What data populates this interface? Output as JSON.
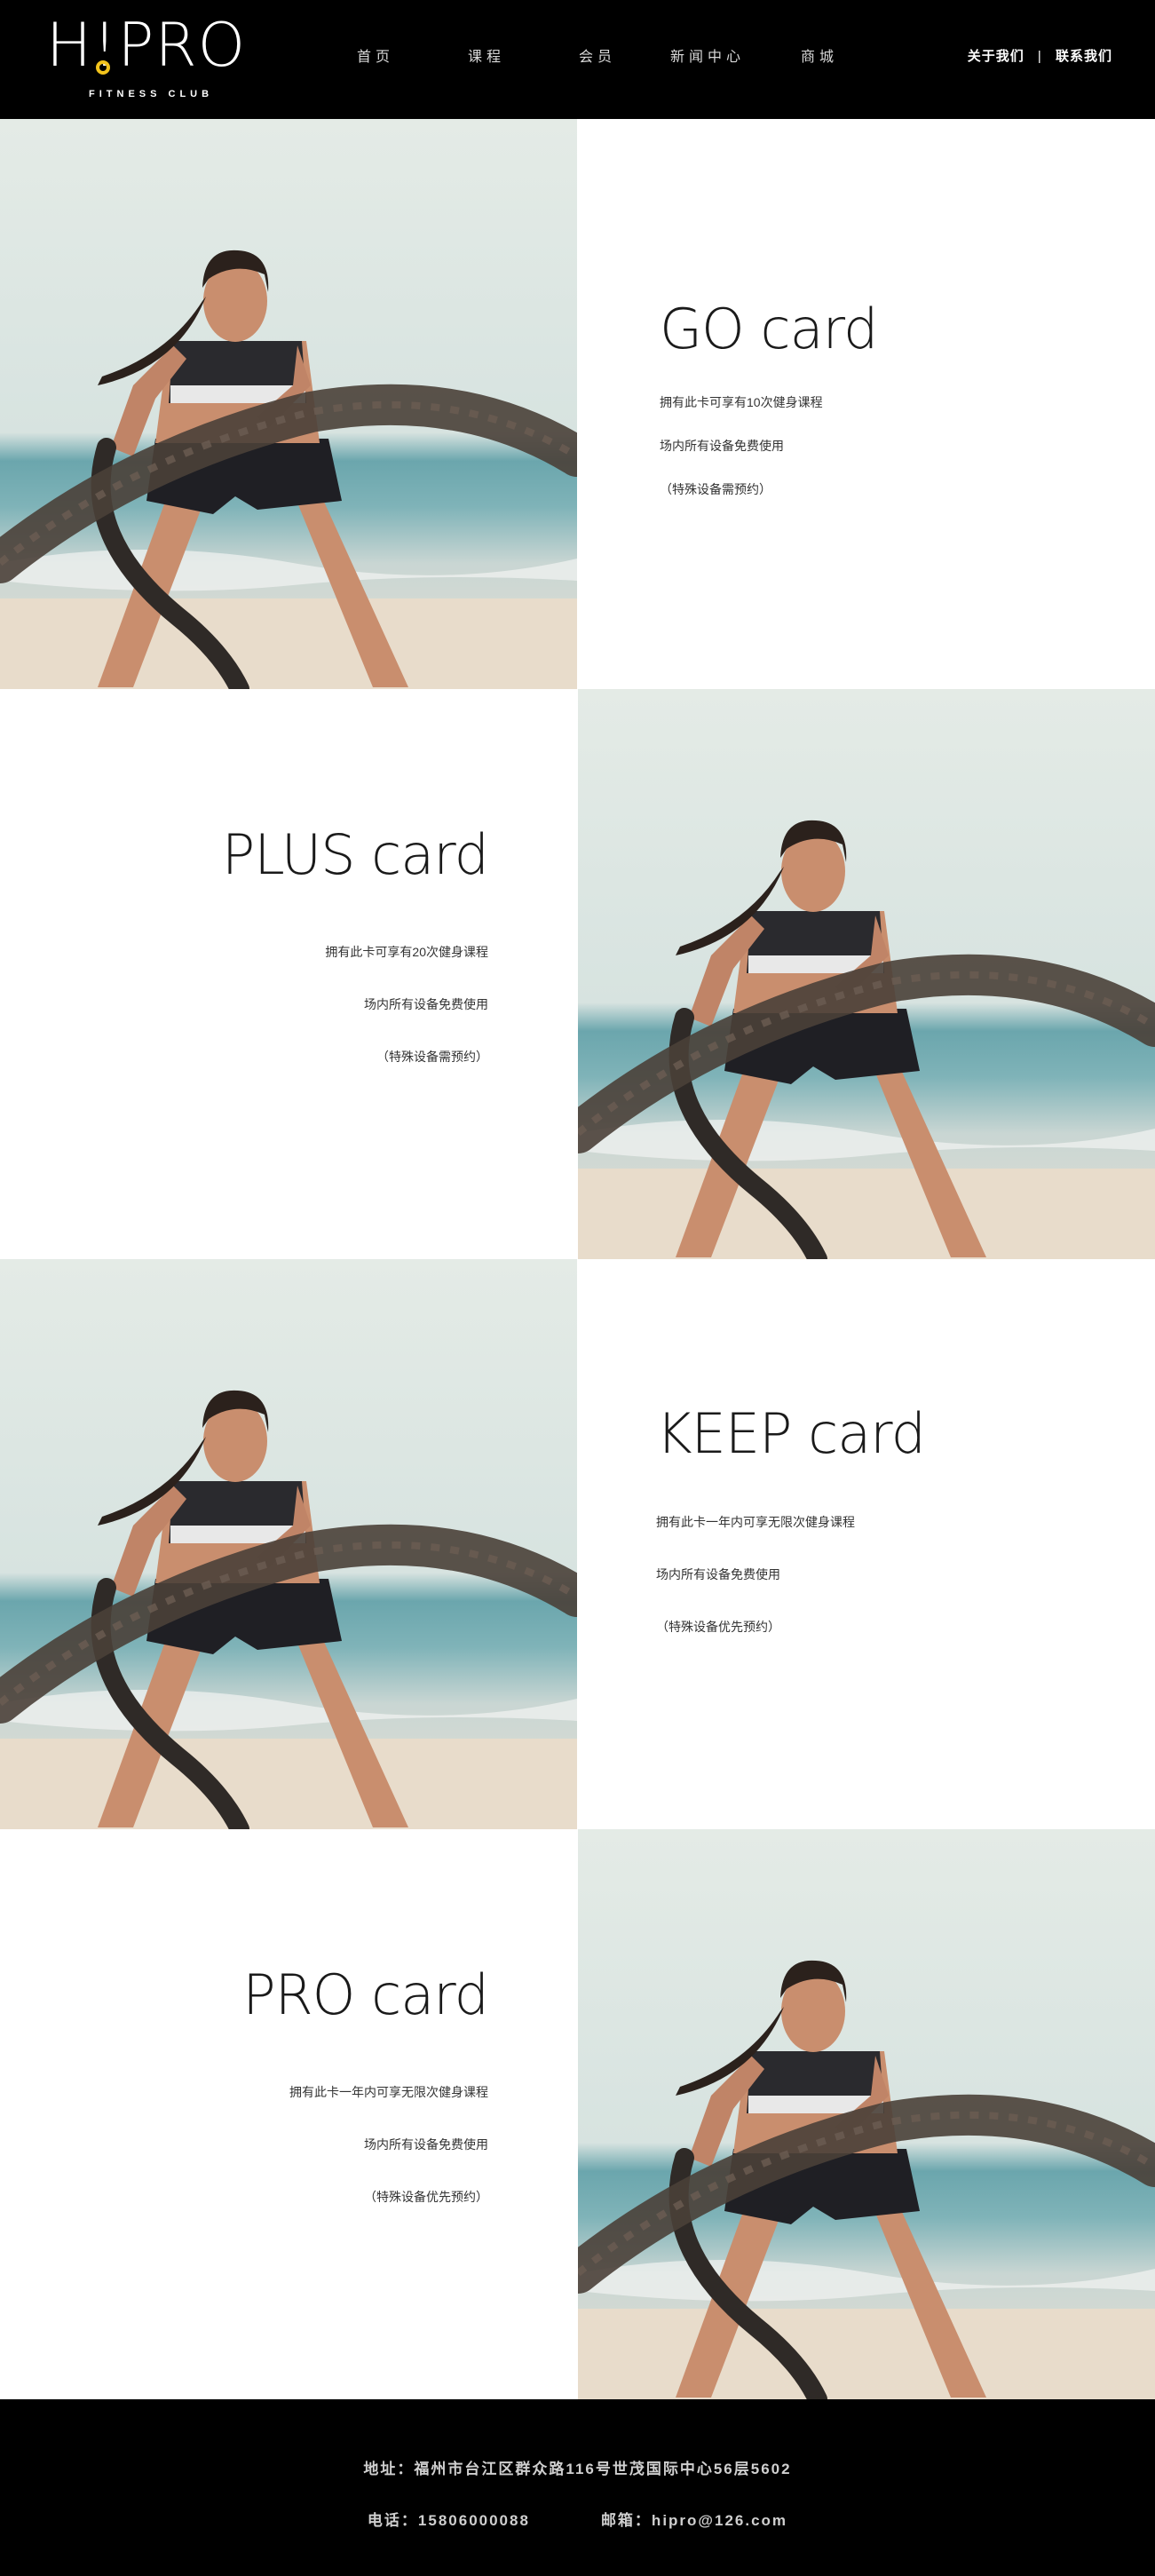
{
  "brand": {
    "logo": "H!PRO",
    "subtitle": "FITNESS CLUB",
    "accent_color": "#f2c31c"
  },
  "nav": {
    "items": [
      {
        "label": "首页"
      },
      {
        "label": "课程"
      },
      {
        "label": "会员"
      },
      {
        "label": "新闻中心"
      },
      {
        "label": "商城"
      }
    ],
    "about": "关于我们",
    "separator": "|",
    "contact": "联系我们"
  },
  "cards": [
    {
      "title": "GO card",
      "lines": [
        "拥有此卡可享有10次健身课程",
        "场内所有设备免费使用",
        "（特殊设备需预约）"
      ]
    },
    {
      "title": "PLUS card",
      "lines": [
        "拥有此卡可享有20次健身课程",
        "场内所有设备免费使用",
        "（特殊设备需预约）"
      ]
    },
    {
      "title": "KEEP card",
      "lines": [
        "拥有此卡一年内可享无限次健身课程",
        "场内所有设备免费使用",
        "（特殊设备优先预约）"
      ]
    },
    {
      "title": "PRO card",
      "lines": [
        "拥有此卡一年内可享无限次健身课程",
        "场内所有设备免费使用",
        "（特殊设备优先预约）"
      ]
    }
  ],
  "footer": {
    "address": "地址：福州市台江区群众路116号世茂国际中心56层5602",
    "phone": "电话：15806000088",
    "email": "邮箱：hipro@126.com"
  },
  "icons": {
    "photo": "fitness-photo-battle-ropes"
  }
}
